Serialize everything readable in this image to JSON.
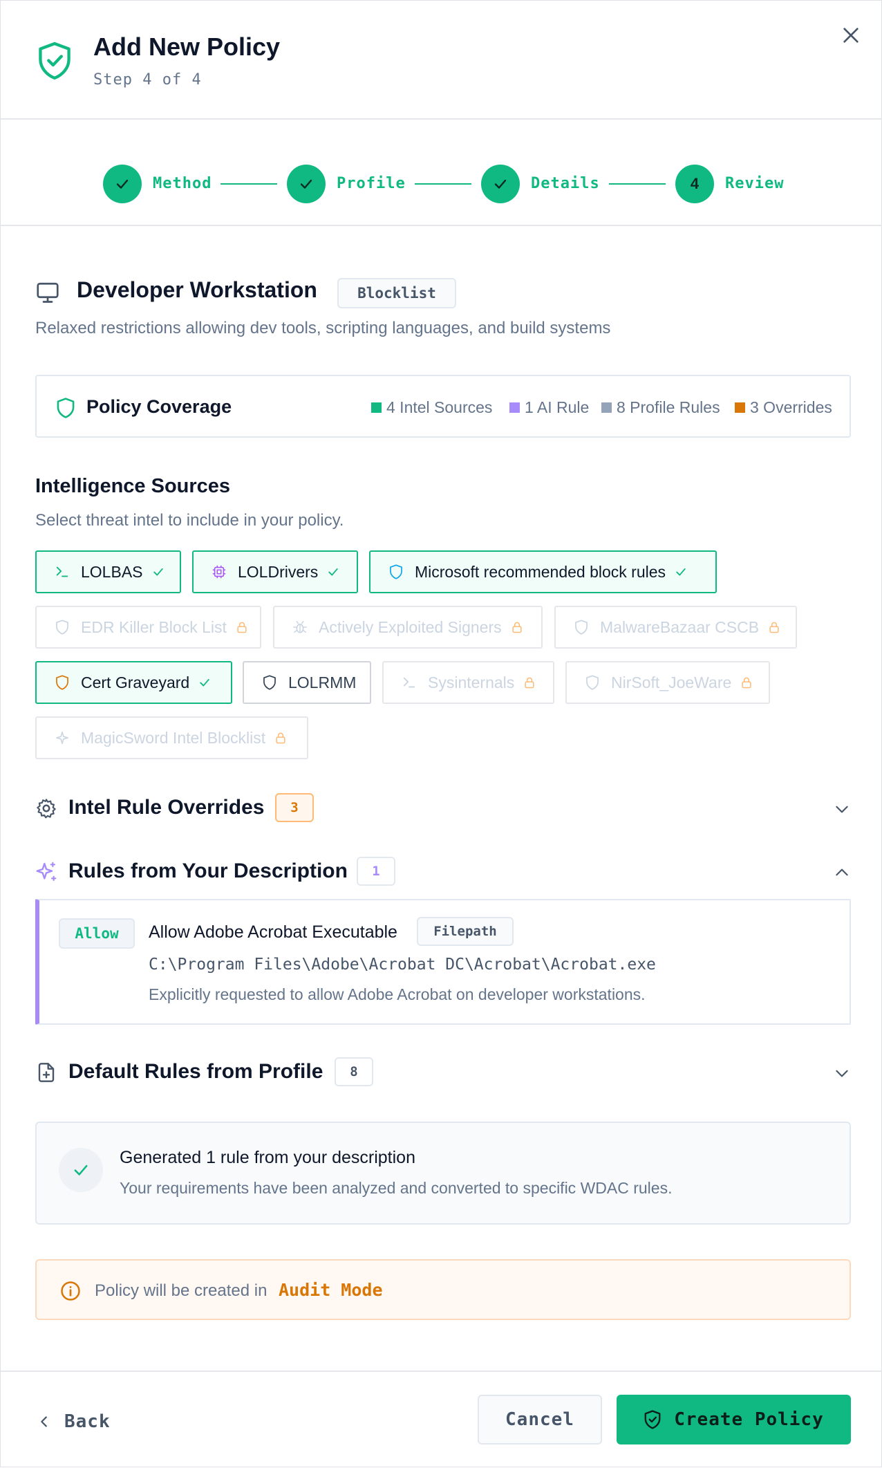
{
  "header": {
    "title": "Add New Policy",
    "subtitle": "Step 4 of 4"
  },
  "stepper": {
    "steps": [
      {
        "label": "Method",
        "state": "complete"
      },
      {
        "label": "Profile",
        "state": "complete"
      },
      {
        "label": "Details",
        "state": "complete"
      },
      {
        "label": "Review",
        "number": "4",
        "state": "current"
      }
    ]
  },
  "profile": {
    "name": "Developer Workstation",
    "type_badge": "Blocklist",
    "description": "Relaxed restrictions allowing dev tools, scripting languages, and build systems"
  },
  "coverage": {
    "title": "Policy Coverage",
    "legend": [
      {
        "label": "4 Intel Sources",
        "color": "#10b981"
      },
      {
        "label": "1 AI Rule",
        "color": "#a78bfa"
      },
      {
        "label": "8 Profile Rules",
        "color": "#94a3b8"
      },
      {
        "label": "3 Overrides",
        "color": "#d97706"
      }
    ]
  },
  "intel": {
    "title": "Intelligence Sources",
    "description": "Select threat intel to include in your policy.",
    "sources": [
      {
        "label": "LOLBAS",
        "state": "selected",
        "icon": "terminal-icon"
      },
      {
        "label": "LOLDrivers",
        "state": "selected",
        "icon": "chip-icon"
      },
      {
        "label": "Microsoft recommended block rules",
        "state": "selected",
        "icon": "shield-icon"
      },
      {
        "label": "EDR Killer Block List",
        "state": "locked",
        "icon": "shield-icon"
      },
      {
        "label": "Actively Exploited Signers",
        "state": "locked",
        "icon": "bug-icon"
      },
      {
        "label": "MalwareBazaar CSCB",
        "state": "locked",
        "icon": "shield-icon"
      },
      {
        "label": "Cert Graveyard",
        "state": "selected",
        "icon": "shield-icon"
      },
      {
        "label": "LOLRMM",
        "state": "available",
        "icon": "shield-icon"
      },
      {
        "label": "Sysinternals",
        "state": "locked",
        "icon": "terminal-icon"
      },
      {
        "label": "NirSoft_JoeWare",
        "state": "locked",
        "icon": "shield-icon"
      },
      {
        "label": "MagicSword Intel Blocklist",
        "state": "locked",
        "icon": "sparkle-icon"
      }
    ]
  },
  "overrides": {
    "title": "Intel Rule Overrides",
    "count": "3"
  },
  "description_rules": {
    "title": "Rules from Your Description",
    "count": "1",
    "rules": [
      {
        "action": "Allow",
        "title": "Allow Adobe Acrobat Executable",
        "type": "Filepath",
        "path": "C:\\Program Files\\Adobe\\Acrobat DC\\Acrobat\\Acrobat.exe",
        "note": "Explicitly requested to allow Adobe Acrobat on developer workstations."
      }
    ]
  },
  "profile_rules": {
    "title": "Default Rules from Profile",
    "count": "8"
  },
  "generated": {
    "title": "Generated 1 rule from your description",
    "description": "Your requirements have been analyzed and converted to specific WDAC rules."
  },
  "audit": {
    "text": "Policy will be created in",
    "mode": "Audit Mode"
  },
  "footer": {
    "back": "Back",
    "cancel": "Cancel",
    "create": "Create Policy"
  }
}
